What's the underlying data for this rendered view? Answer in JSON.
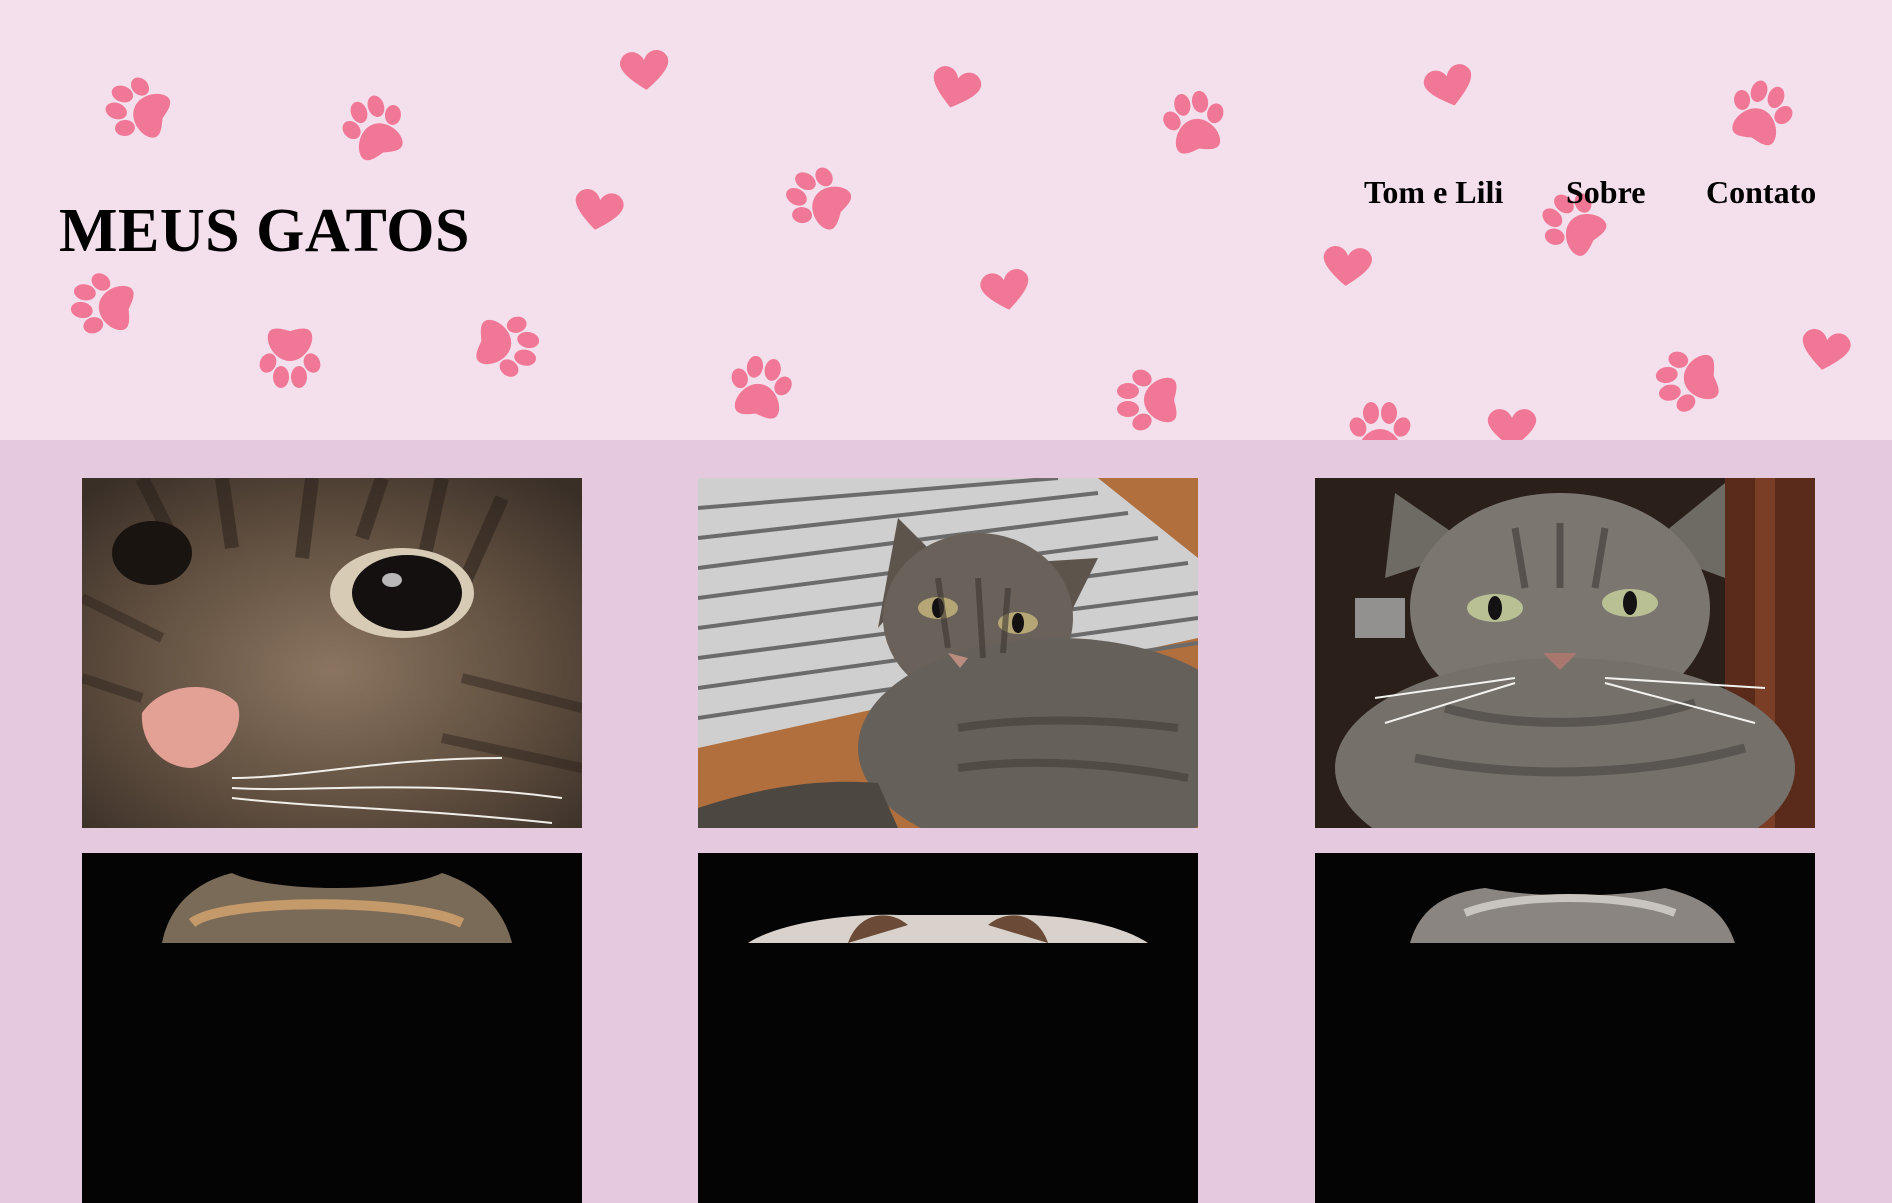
{
  "header": {
    "title": "MEUS GATOS",
    "nav": [
      {
        "label": "Tom e Lili"
      },
      {
        "label": "Sobre"
      },
      {
        "label": "Contato"
      }
    ],
    "colors": {
      "background": "#f3e0ec",
      "paw": "#f07896"
    }
  },
  "gallery": {
    "background": "#e5c9de",
    "photos": [
      {
        "subject": "tabby-cat-closeup"
      },
      {
        "subject": "tabby-cat-on-rug"
      },
      {
        "subject": "tabby-cat-sitting"
      },
      {
        "subject": "cat-dark-background"
      },
      {
        "subject": "cat-dark-background"
      },
      {
        "subject": "cat-dark-background"
      }
    ]
  }
}
